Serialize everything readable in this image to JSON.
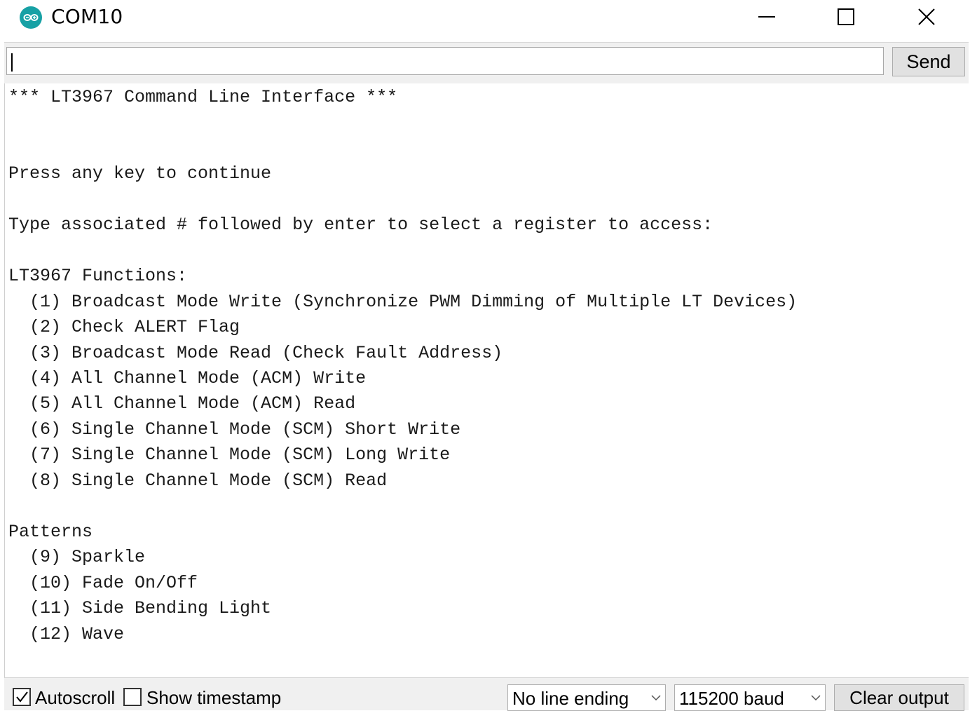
{
  "window": {
    "title": "COM10",
    "icon": "arduino-logo-icon",
    "controls": [
      "minimize-icon",
      "maximize-icon",
      "close-icon"
    ]
  },
  "input": {
    "value": "",
    "send_label": "Send"
  },
  "output": {
    "lines": [
      "*** LT3967 Command Line Interface ***",
      "Press any key to continue",
      "Type associated # followed by enter to select a register to access:",
      "LT3967 Functions:",
      "  (1) Broadcast Mode Write (Synchronize PWM Dimming of Multiple LT Devices)",
      "  (2) Check ALERT Flag",
      "  (3) Broadcast Mode Read (Check Fault Address)",
      "  (4) All Channel Mode (ACM) Write",
      "  (5) All Channel Mode (ACM) Read",
      "  (6) Single Channel Mode (SCM) Short Write",
      "  (7) Single Channel Mode (SCM) Long Write",
      "  (8) Single Channel Mode (SCM) Read",
      "Patterns",
      "  (9) Sparkle",
      "  (10) Fade On/Off",
      "  (11) Side Bending Light",
      "  (12) Wave"
    ]
  },
  "footer": {
    "autoscroll_label": "Autoscroll",
    "autoscroll_checked": true,
    "timestamp_label": "Show timestamp",
    "timestamp_checked": false,
    "line_ending": "No line ending",
    "baud": "115200 baud",
    "clear_label": "Clear output"
  },
  "colors": {
    "arduino_teal": "#17a1a5",
    "bar_bg": "#f0f0f0",
    "button_bg": "#e1e1e1"
  }
}
